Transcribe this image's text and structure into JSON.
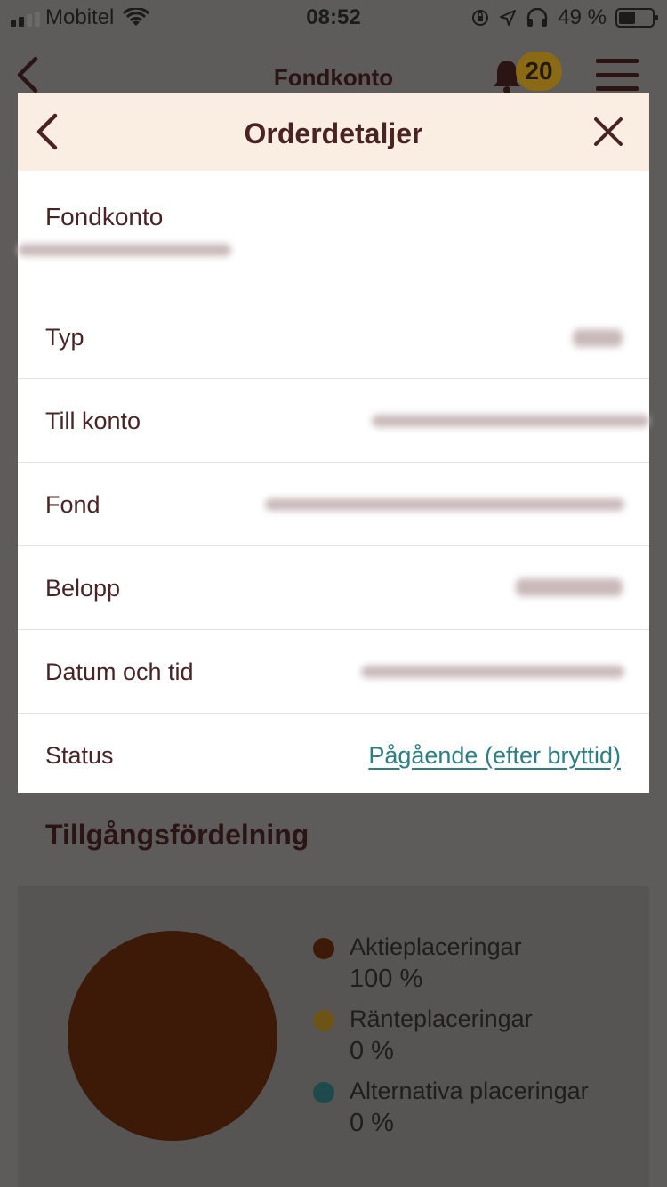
{
  "status_bar": {
    "carrier": "Mobitel",
    "time": "08:52",
    "battery": "49 %",
    "battery_level": 0.49
  },
  "app_header": {
    "title": "Fondkonto",
    "notification_count": "20"
  },
  "modal": {
    "title": "Orderdetaljer",
    "account_name": "Fondkonto",
    "rows": [
      {
        "label": "Typ",
        "value": ""
      },
      {
        "label": "Till konto",
        "value": ""
      },
      {
        "label": "Fond",
        "value": ""
      },
      {
        "label": "Belopp",
        "value": ""
      },
      {
        "label": "Datum och tid",
        "value": ""
      },
      {
        "label": "Status",
        "value": "Pågående (efter bryttid)"
      }
    ]
  },
  "allocation": {
    "title": "Tillgångsfördelning",
    "items": [
      {
        "name": "Aktieplaceringar",
        "value": "100 %",
        "color": "#3d1a08"
      },
      {
        "name": "Ränteplaceringar",
        "value": "0 %",
        "color": "#6b5416"
      },
      {
        "name": "Alternativa placeringar",
        "value": "0 %",
        "color": "#1d4a4c"
      }
    ]
  },
  "colors": {
    "brand_text": "#4a2424",
    "modal_header_bg": "#faeee2",
    "link": "#2c7f82",
    "overlay": "#5d5c5b"
  }
}
